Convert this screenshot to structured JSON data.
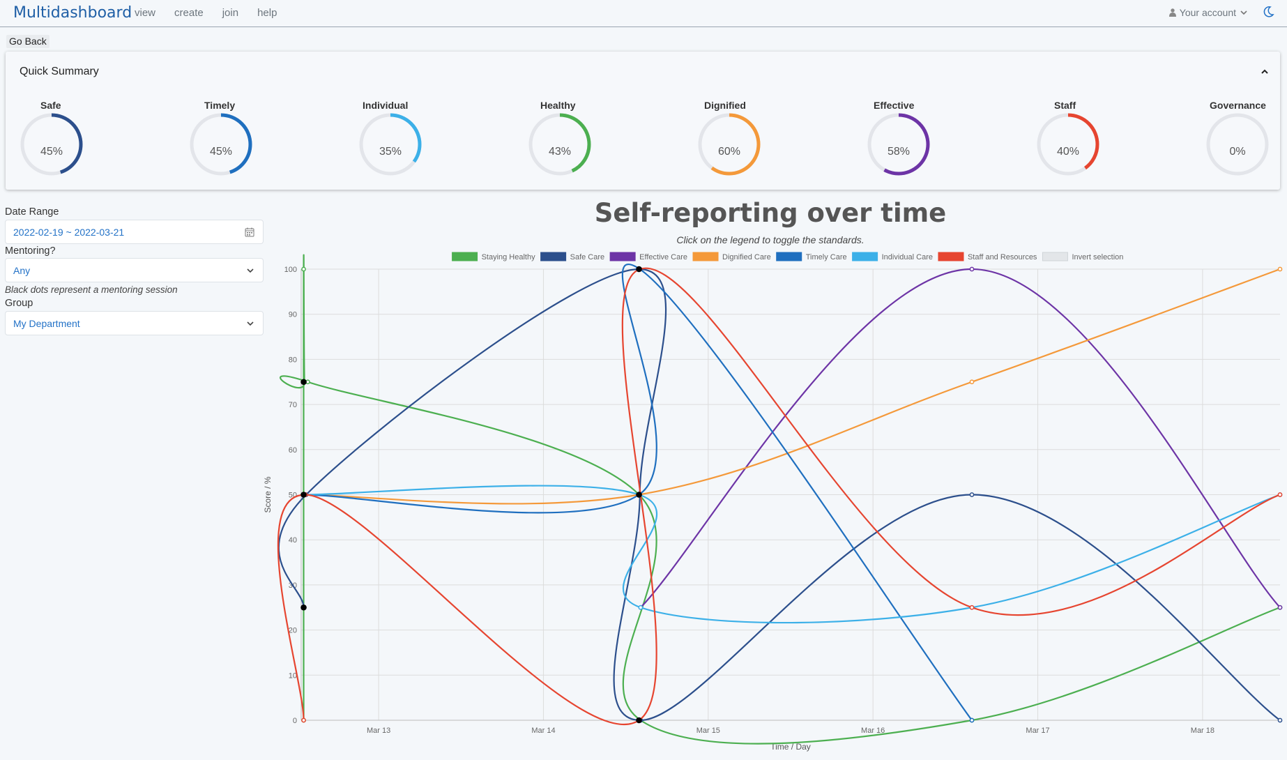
{
  "app": {
    "brand": "Multidashboard"
  },
  "nav": {
    "links": [
      "view",
      "create",
      "join",
      "help"
    ],
    "account_label": "Your account"
  },
  "go_back": "Go Back",
  "summary": {
    "title": "Quick Summary",
    "gauges": [
      {
        "label": "Safe",
        "value": 45,
        "text": "45%",
        "color": "#2c4f8c"
      },
      {
        "label": "Timely",
        "value": 45,
        "text": "45%",
        "color": "#1f6fbf"
      },
      {
        "label": "Individual",
        "value": 35,
        "text": "35%",
        "color": "#3cb0e8"
      },
      {
        "label": "Healthy",
        "value": 43,
        "text": "43%",
        "color": "#4caf50"
      },
      {
        "label": "Dignified",
        "value": 60,
        "text": "60%",
        "color": "#f4993a"
      },
      {
        "label": "Effective",
        "value": 58,
        "text": "58%",
        "color": "#6d34a6"
      },
      {
        "label": "Staff",
        "value": 40,
        "text": "40%",
        "color": "#e64530"
      },
      {
        "label": "Governance",
        "value": 0,
        "text": "0%",
        "color": "#999999"
      }
    ]
  },
  "filters": {
    "date_range_label": "Date Range",
    "date_range_value": "2022-02-19 ~ 2022-03-21",
    "mentoring_label": "Mentoring?",
    "mentoring_value": "Any",
    "mentoring_note": "Black dots represent a mentoring session",
    "group_label": "Group",
    "group_value": "My Department"
  },
  "chart_data": {
    "type": "line",
    "title": "Self-reporting over time",
    "subtitle": "Click on the legend to toggle the standards.",
    "xlabel": "Time / Day",
    "ylabel": "Score / %",
    "ylim": [
      0,
      100
    ],
    "yticks": [
      0,
      10,
      20,
      30,
      40,
      50,
      60,
      70,
      80,
      90,
      100
    ],
    "xticks": [
      {
        "t": 13.0,
        "label": "Mar 13"
      },
      {
        "t": 14.0,
        "label": "Mar 14"
      },
      {
        "t": 15.0,
        "label": "Mar 15"
      },
      {
        "t": 16.0,
        "label": "Mar 16"
      },
      {
        "t": 17.0,
        "label": "Mar 17"
      },
      {
        "t": 18.0,
        "label": "Mar 18"
      }
    ],
    "xlim": [
      12.53,
      18.47
    ],
    "grid": true,
    "legend_position": "top",
    "invert_label": "Invert selection",
    "series": [
      {
        "name": "Staying Healthy",
        "color": "#4caf50",
        "points": [
          [
            12.545,
            0
          ],
          [
            12.545,
            100
          ],
          [
            12.55,
            75
          ],
          [
            12.57,
            75
          ],
          [
            14.58,
            50
          ],
          [
            14.59,
            0
          ],
          [
            16.6,
            0
          ],
          [
            18.47,
            25
          ]
        ]
      },
      {
        "name": "Safe Care",
        "color": "#2c4f8c",
        "points": [
          [
            12.545,
            25
          ],
          [
            12.56,
            50
          ],
          [
            14.58,
            100
          ],
          [
            14.585,
            50
          ],
          [
            14.59,
            0
          ],
          [
            16.6,
            50
          ],
          [
            18.47,
            0
          ]
        ]
      },
      {
        "name": "Effective Care",
        "color": "#6d34a6",
        "points": [
          [
            14.59,
            25
          ],
          [
            16.6,
            100
          ],
          [
            18.47,
            25
          ]
        ]
      },
      {
        "name": "Dignified Care",
        "color": "#f4993a",
        "points": [
          [
            12.545,
            50
          ],
          [
            14.58,
            50
          ],
          [
            16.6,
            75
          ],
          [
            18.47,
            100
          ]
        ]
      },
      {
        "name": "Timely Care",
        "color": "#1f6fbf",
        "points": [
          [
            12.545,
            50
          ],
          [
            14.58,
            50
          ],
          [
            14.585,
            100
          ],
          [
            16.6,
            0
          ]
        ]
      },
      {
        "name": "Individual Care",
        "color": "#3cb0e8",
        "points": [
          [
            12.545,
            50
          ],
          [
            14.58,
            50
          ],
          [
            14.59,
            25
          ],
          [
            16.6,
            25
          ],
          [
            18.47,
            50
          ]
        ]
      },
      {
        "name": "Staff and Resources",
        "color": "#e64530",
        "points": [
          [
            12.545,
            0
          ],
          [
            12.555,
            50
          ],
          [
            14.58,
            0
          ],
          [
            14.585,
            100
          ],
          [
            16.6,
            25
          ],
          [
            18.47,
            50
          ]
        ]
      }
    ],
    "mentoring_sessions": [
      [
        12.545,
        75
      ],
      [
        12.545,
        50
      ],
      [
        12.545,
        25
      ],
      [
        14.58,
        100
      ],
      [
        14.58,
        50
      ],
      [
        14.58,
        0
      ]
    ]
  }
}
